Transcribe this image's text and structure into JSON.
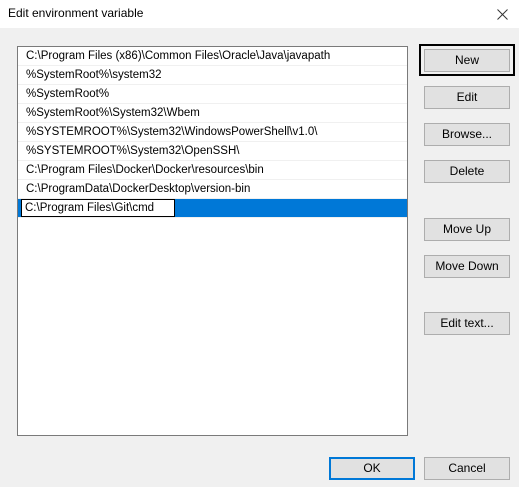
{
  "window": {
    "title": "Edit environment variable"
  },
  "list": {
    "items": [
      "C:\\Program Files (x86)\\Common Files\\Oracle\\Java\\javapath",
      "%SystemRoot%\\system32",
      "%SystemRoot%",
      "%SystemRoot%\\System32\\Wbem",
      "%SYSTEMROOT%\\System32\\WindowsPowerShell\\v1.0\\",
      "%SYSTEMROOT%\\System32\\OpenSSH\\",
      "C:\\Program Files\\Docker\\Docker\\resources\\bin",
      "C:\\ProgramData\\DockerDesktop\\version-bin"
    ],
    "editing_value": "C:\\Program Files\\Git\\cmd"
  },
  "buttons": {
    "new": "New",
    "edit": "Edit",
    "browse": "Browse...",
    "delete": "Delete",
    "move_up": "Move Up",
    "move_down": "Move Down",
    "edit_text": "Edit text...",
    "ok": "OK",
    "cancel": "Cancel"
  },
  "colors": {
    "selection": "#0078d7",
    "background": "#f0f0f0"
  }
}
